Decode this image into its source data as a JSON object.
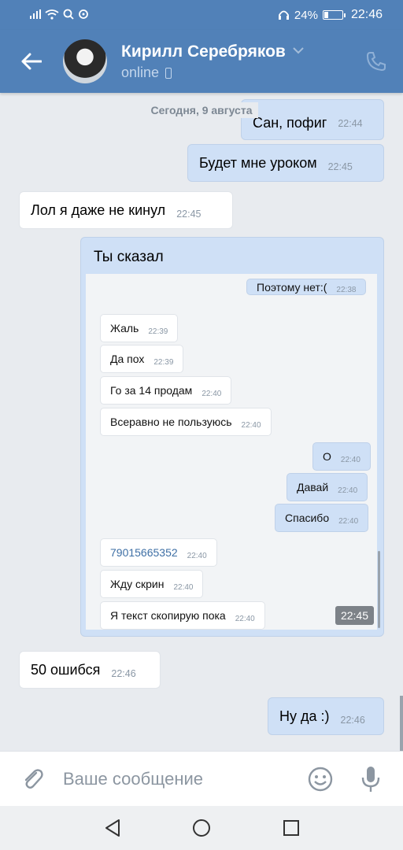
{
  "status_bar": {
    "battery": "24%",
    "battery_level": 0.24,
    "time": "22:46"
  },
  "header": {
    "name": "Кирилл Серебряков",
    "status": "online"
  },
  "chat": {
    "date": "Сегодня, 9 августа",
    "messages": [
      {
        "text": "Сан, пофиг",
        "time": "22:44"
      },
      {
        "text": "Будет мне уроком",
        "time": "22:45"
      },
      {
        "text": "Лол я даже не кинул",
        "time": "22:45"
      },
      {
        "text": "50 ошибся",
        "time": "22:46"
      },
      {
        "text": "Ну да :)",
        "time": "22:46"
      }
    ],
    "forwarded": {
      "title": "Ты сказал",
      "time": "22:45",
      "messages": [
        {
          "text": "Поэтому нет:(",
          "time": "22:38"
        },
        {
          "text": "Жаль",
          "time": "22:39"
        },
        {
          "text": "Да пох",
          "time": "22:39"
        },
        {
          "text": "Го за 14 продам",
          "time": "22:40"
        },
        {
          "text": "Всеравно не пользуюсь",
          "time": "22:40"
        },
        {
          "text": "О",
          "time": "22:40"
        },
        {
          "text": "Давай",
          "time": "22:40"
        },
        {
          "text": "Спасибо",
          "time": "22:40"
        },
        {
          "text": "79015665352",
          "time": "22:40"
        },
        {
          "text": "Жду скрин",
          "time": "22:40"
        },
        {
          "text": "Я текст скопирую пока",
          "time": "22:40"
        }
      ]
    }
  },
  "input": {
    "placeholder": "Ваше сообщение"
  },
  "icons": {
    "back": "arrow-left-icon",
    "call": "phone-icon",
    "attach": "paperclip-icon",
    "emoji": "smile-icon",
    "mic": "microphone-icon",
    "nav_back": "triangle-back-icon",
    "nav_home": "circle-home-icon",
    "nav_recent": "square-recent-icon"
  },
  "colors": {
    "header": "#5181b8",
    "outgoing": "#cfe0f6",
    "incoming": "#ffffff",
    "background": "#e8ebef"
  }
}
